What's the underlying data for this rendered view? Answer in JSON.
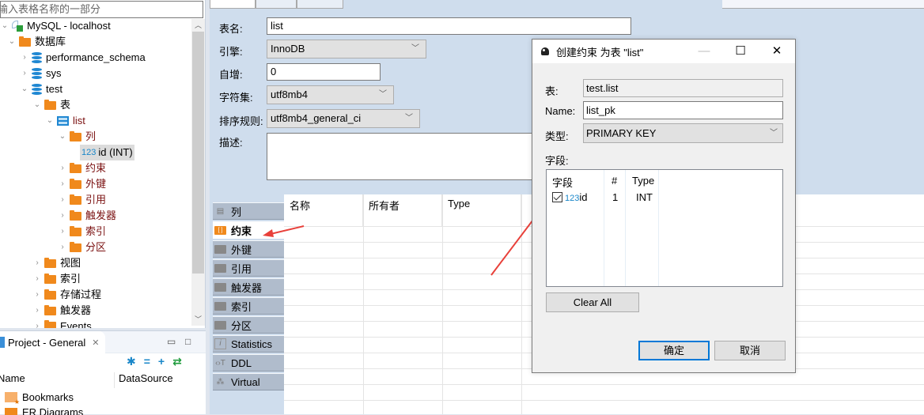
{
  "navigator": {
    "filter_placeholder": "输入表格名称的一部分",
    "tree": [
      {
        "label": "MySQL - localhost",
        "level": 0,
        "icon": "mysql-connection-icon",
        "expanded": true
      },
      {
        "label": "数据库",
        "level": 1,
        "icon": "databases-folder-icon",
        "expanded": true
      },
      {
        "label": "performance_schema",
        "level": 2,
        "icon": "database-icon",
        "expanded": false
      },
      {
        "label": "sys",
        "level": 2,
        "icon": "database-icon",
        "expanded": false
      },
      {
        "label": "test",
        "level": 2,
        "icon": "database-icon",
        "expanded": true
      },
      {
        "label": "表",
        "level": 3,
        "icon": "tables-folder-icon",
        "expanded": true
      },
      {
        "label": "list",
        "level": 4,
        "icon": "table-icon",
        "expanded": true
      },
      {
        "label": "列",
        "level": 5,
        "icon": "columns-folder-icon",
        "expanded": true
      },
      {
        "label": "id (INT)",
        "level": 6,
        "icon": "numeric-column-icon",
        "selected": true
      },
      {
        "label": "约束",
        "level": 5,
        "icon": "constraints-folder-icon",
        "expanded": false
      },
      {
        "label": "外键",
        "level": 5,
        "icon": "folder-icon",
        "expanded": false
      },
      {
        "label": "引用",
        "level": 5,
        "icon": "folder-icon",
        "expanded": false
      },
      {
        "label": "触发器",
        "level": 5,
        "icon": "folder-icon",
        "expanded": false
      },
      {
        "label": "索引",
        "level": 5,
        "icon": "folder-icon",
        "expanded": false
      },
      {
        "label": "分区",
        "level": 5,
        "icon": "folder-icon",
        "expanded": false
      },
      {
        "label": "视图",
        "level": 3,
        "icon": "views-folder-icon",
        "expanded": false
      },
      {
        "label": "索引",
        "level": 3,
        "icon": "folder-icon",
        "expanded": false
      },
      {
        "label": "存储过程",
        "level": 3,
        "icon": "folder-icon",
        "expanded": false
      },
      {
        "label": "触发器",
        "level": 3,
        "icon": "folder-icon",
        "expanded": false
      },
      {
        "label": "Events",
        "level": 3,
        "icon": "folder-icon",
        "expanded": false
      }
    ],
    "numeric_badge": "123"
  },
  "project_panel": {
    "tab_title": "Project - General",
    "columns": [
      "Name",
      "DataSource"
    ],
    "rows": [
      {
        "label": "Bookmarks",
        "icon": "bookmarks-folder-icon"
      },
      {
        "label": "ER Diagrams",
        "icon": "er-diagrams-folder-icon"
      }
    ]
  },
  "editor": {
    "form": {
      "table_name_label": "表名:",
      "table_name_value": "list",
      "engine_label": "引擎:",
      "engine_value": "InnoDB",
      "auto_increment_label": "自增:",
      "auto_increment_value": "0",
      "charset_label": "字符集:",
      "charset_value": "utf8mb4",
      "collation_label": "排序规则:",
      "collation_value": "utf8mb4_general_ci",
      "description_label": "描述:",
      "description_value": ""
    },
    "side_tabs": [
      {
        "label": "列",
        "icon": "columns-icon",
        "active": false
      },
      {
        "label": "约束",
        "icon": "constraints-icon",
        "active": true
      },
      {
        "label": "外键",
        "icon": "folder-icon",
        "active": false
      },
      {
        "label": "引用",
        "icon": "folder-icon",
        "active": false
      },
      {
        "label": "触发器",
        "icon": "folder-icon",
        "active": false
      },
      {
        "label": "索引",
        "icon": "folder-icon",
        "active": false
      },
      {
        "label": "分区",
        "icon": "folder-icon",
        "active": false
      },
      {
        "label": "Statistics",
        "icon": "info-icon",
        "active": false
      },
      {
        "label": "DDL",
        "icon": "ddl-icon",
        "active": false
      },
      {
        "label": "Virtual",
        "icon": "virtual-icon",
        "active": false
      }
    ],
    "grid_columns": [
      "名称",
      "所有者",
      "Type"
    ]
  },
  "dialog": {
    "title": "创建约束 为表 \"list\"",
    "table_label": "表:",
    "table_value": "test.list",
    "name_label": "Name:",
    "name_value": "list_pk",
    "type_label": "类型:",
    "type_value": "PRIMARY KEY",
    "fields_label": "字段:",
    "fields_columns": [
      "字段",
      "#",
      "Type"
    ],
    "fields_rows": [
      {
        "checked": true,
        "badge": "123",
        "name": "id",
        "position": "1",
        "type": "INT"
      }
    ],
    "clear_all_label": "Clear All",
    "ok_label": "确定",
    "cancel_label": "取消"
  },
  "colors": {
    "accent_blue": "#0078d7",
    "folder_orange": "#f0891c",
    "annotation_arrow": "#e8403a",
    "editor_bg": "#cfdded"
  }
}
